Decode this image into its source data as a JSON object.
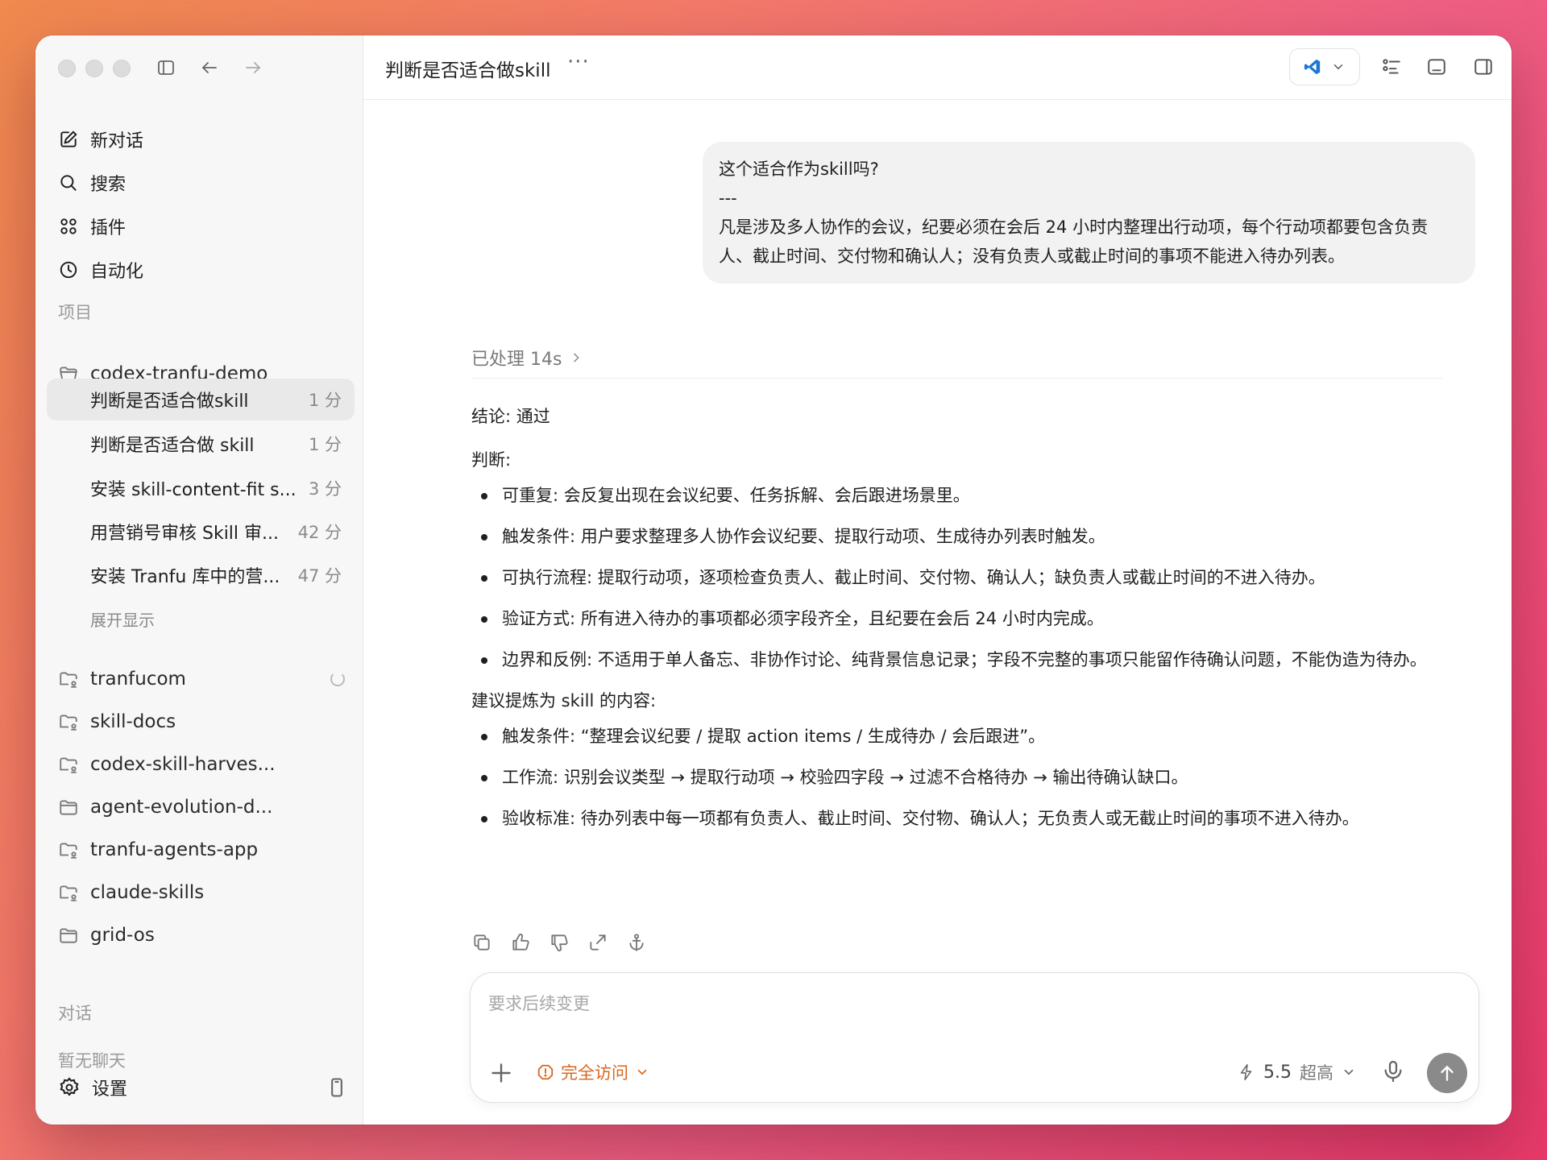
{
  "sidebar": {
    "nav": [
      {
        "label": "新对话",
        "icon": "edit-icon"
      },
      {
        "label": "搜索",
        "icon": "search-icon"
      },
      {
        "label": "插件",
        "icon": "plugins-icon"
      },
      {
        "label": "自动化",
        "icon": "clock-icon"
      }
    ],
    "projects_label": "项目",
    "current_project": "codex-tranfu-demo",
    "threads": [
      {
        "title": "判断是否适合做skill",
        "time": "1 分",
        "active": true
      },
      {
        "title": "判断是否适合做 skill",
        "time": "1 分"
      },
      {
        "title": "安装 skill-content-fit s...",
        "time": "3 分"
      },
      {
        "title": "用营销号审核 Skill 审...",
        "time": "42 分"
      },
      {
        "title": "安装 Tranfu 库中的营...",
        "time": "47 分"
      }
    ],
    "expand_label": "展开显示",
    "projects": [
      {
        "name": "tranfucom"
      },
      {
        "name": "skill-docs"
      },
      {
        "name": "codex-skill-harves..."
      },
      {
        "name": "agent-evolution-d..."
      },
      {
        "name": "tranfu-agents-app"
      },
      {
        "name": "claude-skills"
      },
      {
        "name": "grid-os"
      }
    ],
    "chats_label": "对话",
    "no_chats": "暂无聊天",
    "settings_label": "设置"
  },
  "topbar": {
    "title": "判断是否适合做skill",
    "more": "···"
  },
  "user_message": {
    "line1": "这个适合作为skill吗?",
    "line2": "---",
    "line3": "凡是涉及多人协作的会议，纪要必须在会后 24 小时内整理出行动项，每个行动项都要包含负责人、截止时间、交付物和确认人；没有负责人或截止时间的事项不能进入待办列表。"
  },
  "processed": "已处理 14s",
  "answer": {
    "conclusion": "结论: 通过",
    "judgement_label": "判断:",
    "judgements": [
      "可重复: 会反复出现在会议纪要、任务拆解、会后跟进场景里。",
      "触发条件: 用户要求整理多人协作会议纪要、提取行动项、生成待办列表时触发。",
      "可执行流程: 提取行动项，逐项检查负责人、截止时间、交付物、确认人；缺负责人或截止时间的不进入待办。",
      "验证方式: 所有进入待办的事项都必须字段齐全，且纪要在会后 24 小时内完成。",
      "边界和反例: 不适用于单人备忘、非协作讨论、纯背景信息记录；字段不完整的事项只能留作待确认问题，不能伪造为待办。"
    ],
    "suggest_label": "建议提炼为 skill 的内容:",
    "suggestions": [
      "触发条件: “整理会议纪要 / 提取 action items / 生成待办 / 会后跟进”。",
      "工作流: 识别会议类型 → 提取行动项 → 校验四字段 → 过滤不合格待办 → 输出待确认缺口。",
      "验收标准: 待办列表中每一项都有负责人、截止时间、交付物、确认人；无负责人或无截止时间的事项不进入待办。"
    ]
  },
  "composer": {
    "placeholder": "要求后续变更",
    "access": "完全访问",
    "model_version": "5.5",
    "model_level": "超高"
  },
  "colors": {
    "accent_orange": "#d8661e",
    "vscode_blue": "#1f76d2"
  }
}
